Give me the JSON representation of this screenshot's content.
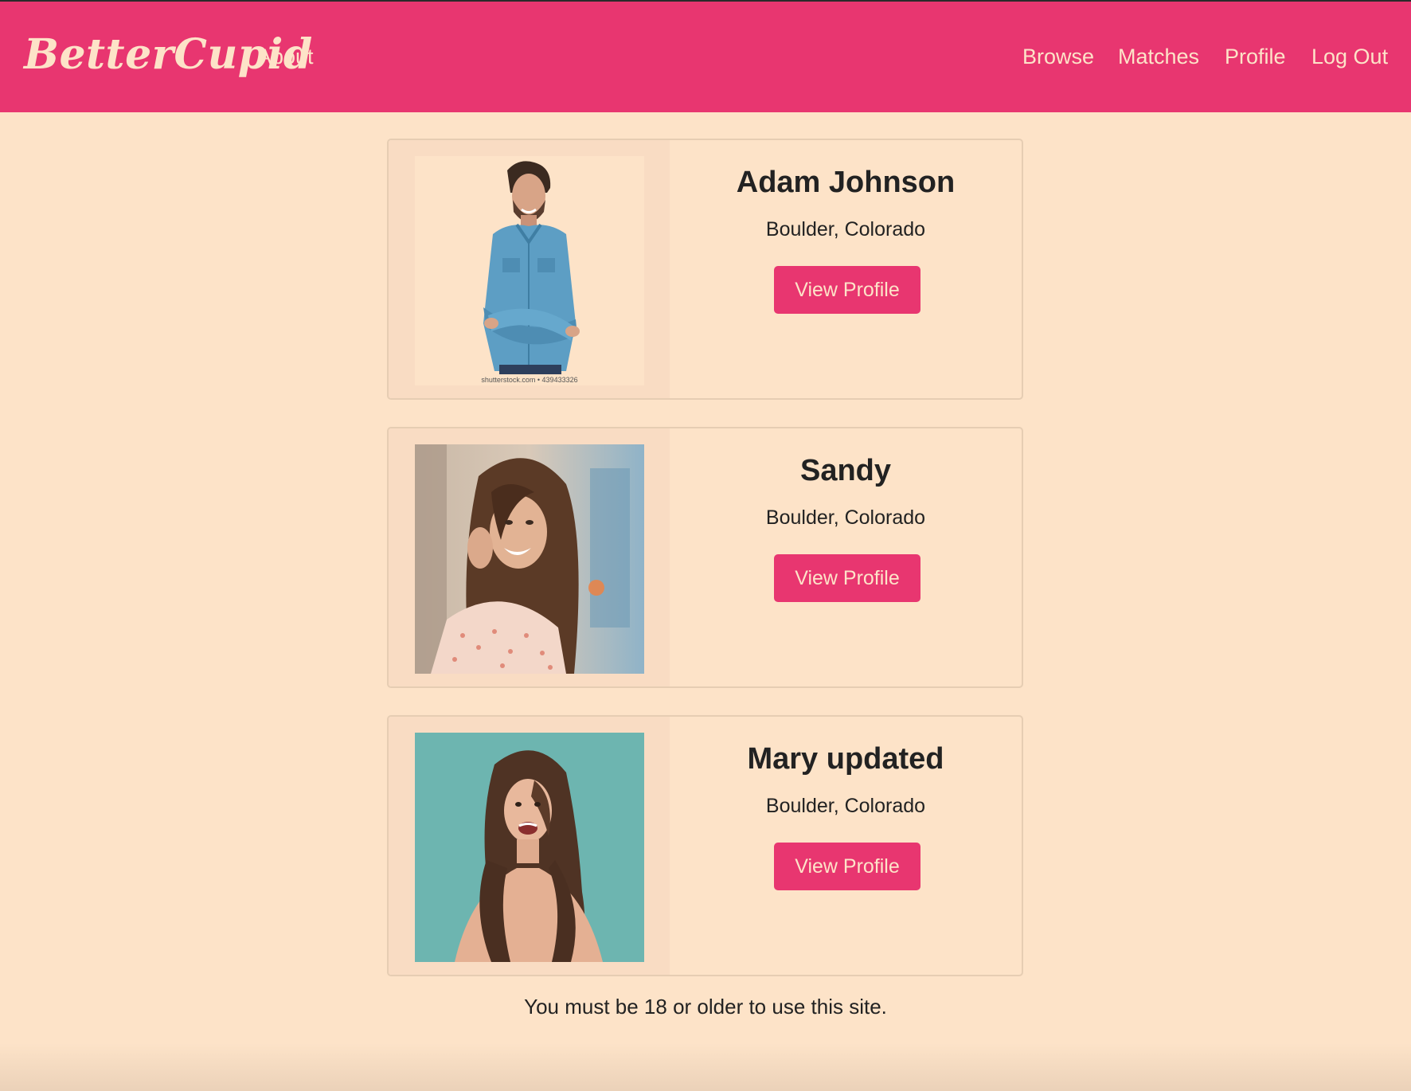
{
  "navbar": {
    "brand": "BetterCupid",
    "about": "About",
    "links": {
      "browse": "Browse",
      "matches": "Matches",
      "profile": "Profile",
      "logout": "Log Out"
    }
  },
  "profiles": [
    {
      "name": "Adam Johnson",
      "location": "Boulder, Colorado",
      "button": "View Profile",
      "photo_caption": "shutterstock.com • 439433326"
    },
    {
      "name": "Sandy",
      "location": "Boulder, Colorado",
      "button": "View Profile"
    },
    {
      "name": "Mary updated",
      "location": "Boulder, Colorado",
      "button": "View Profile"
    }
  ],
  "footer": {
    "notice": "You must be 18 or older to use this site."
  },
  "colors": {
    "accent": "#e83670",
    "background": "#fde3c8",
    "media_panel": "#f9dcc3"
  },
  "icons": {
    "photos": [
      "man-denim-shirt-photo",
      "woman-smiling-city-photo",
      "woman-laughing-teal-photo"
    ]
  }
}
